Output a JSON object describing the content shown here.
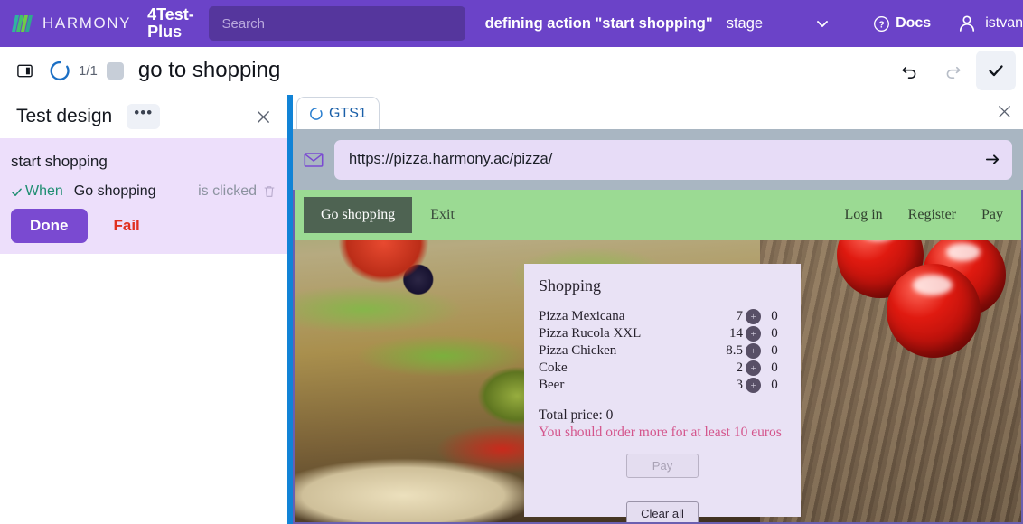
{
  "topbar": {
    "logo_text": "HARMONY",
    "app_name": "4Test-Plus",
    "search_placeholder": "Search",
    "context_title": "defining action \"start shopping\"",
    "stage_label": "stage",
    "docs_label": "Docs",
    "user_label": "istvan",
    "bg_color": "#6b43c8"
  },
  "toolbar": {
    "step_count": "1/1",
    "title": "go to shopping",
    "undo_title": "Undo",
    "redo_title": "Redo",
    "confirm_title": "Confirm"
  },
  "left_panel": {
    "title": "Test design",
    "menu_label": "•••",
    "close_label": "✕",
    "action_name": "start shopping",
    "when_label": "When",
    "target_label": "Go shopping",
    "event_label": "is clicked",
    "done_label": "Done",
    "fail_label": "Fail"
  },
  "browser": {
    "tab_label": "GTS1",
    "tab_close_label": "✕",
    "url": "https://pizza.harmony.ac/pizza/",
    "go_label": "→"
  },
  "site": {
    "nav": {
      "go_shopping": "Go shopping",
      "exit": "Exit",
      "links": [
        "Log in",
        "Register",
        "Pay"
      ]
    },
    "dialog": {
      "title": "Shopping",
      "items": [
        {
          "name": "Pizza Mexicana",
          "price": "7",
          "plus": "+",
          "qty": "0"
        },
        {
          "name": "Pizza Rucola XXL",
          "price": "14",
          "plus": "+",
          "qty": "0"
        },
        {
          "name": "Pizza Chicken",
          "price": "8.5",
          "plus": "+",
          "qty": "0"
        },
        {
          "name": "Coke",
          "price": "2",
          "plus": "+",
          "qty": "0"
        },
        {
          "name": "Beer",
          "price": "3",
          "plus": "+",
          "qty": "0"
        }
      ],
      "total_label": "Total price: 0",
      "warning": "You should order more for at least 10 euros",
      "pay_label": "Pay",
      "clear_label": "Clear all"
    }
  },
  "colors": {
    "brand_purple": "#6b43c8",
    "accent_blue": "#1183d6",
    "card_lavender": "#eddffb",
    "site_green": "#9bda93",
    "warn_pink": "#d4558c",
    "fail_red": "#e03020"
  }
}
